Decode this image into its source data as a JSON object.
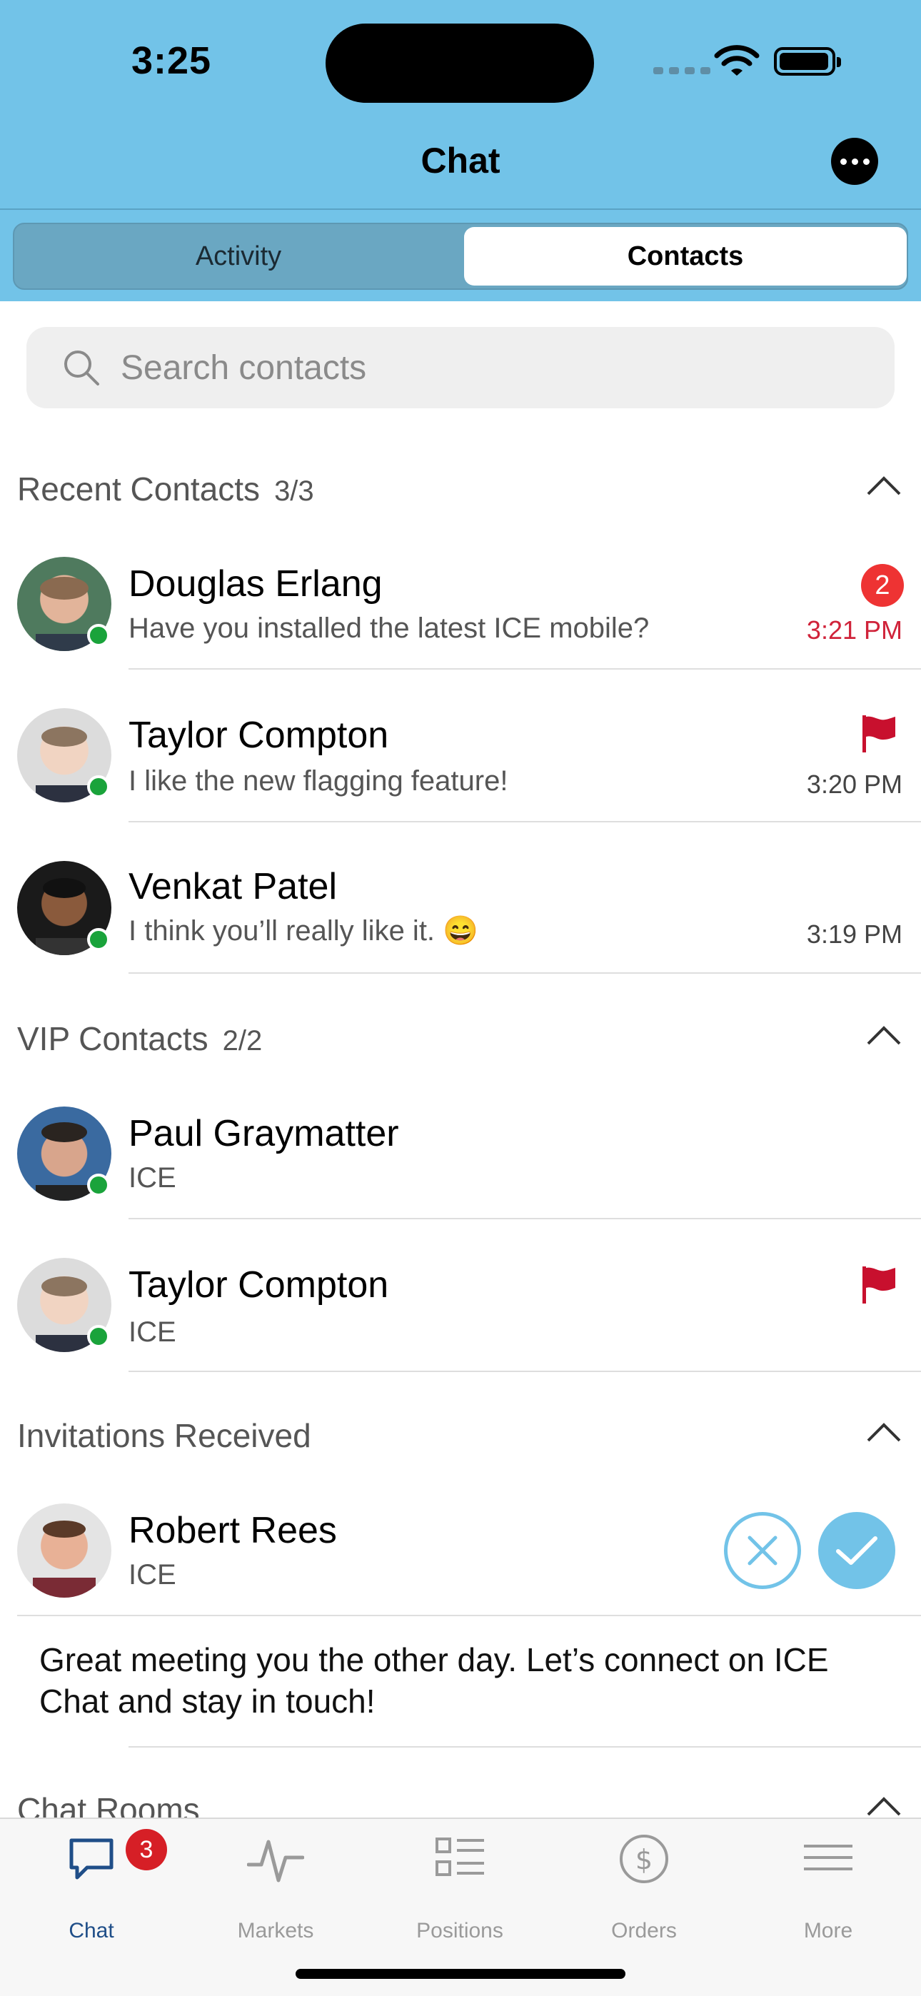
{
  "status_bar": {
    "time": "3:25"
  },
  "nav": {
    "title": "Chat"
  },
  "segments": {
    "activity": "Activity",
    "contacts": "Contacts"
  },
  "search": {
    "placeholder": "Search contacts"
  },
  "recent": {
    "title": "Recent Contacts",
    "count": "3/3",
    "items": [
      {
        "name": "Douglas Erlang",
        "message": "Have you installed the latest ICE mobile?",
        "time": "3:21 PM",
        "badge": "2"
      },
      {
        "name": "Taylor Compton",
        "message": "I like the new flagging feature!",
        "time": "3:20 PM"
      },
      {
        "name": "Venkat Patel",
        "message": "I think you’ll really like it. 😄",
        "time": "3:19 PM"
      }
    ]
  },
  "vip": {
    "title": "VIP Contacts",
    "count": "2/2",
    "items": [
      {
        "name": "Paul Graymatter",
        "company": "ICE"
      },
      {
        "name": "Taylor Compton",
        "company": "ICE"
      }
    ]
  },
  "invitations": {
    "title": "Invitations Received",
    "items": [
      {
        "name": "Robert Rees",
        "company": "ICE",
        "message": "Great meeting you the other day. Let’s connect on ICE Chat and stay in touch!"
      }
    ]
  },
  "chat_rooms": {
    "title": "Chat Rooms"
  },
  "tabbar": {
    "chat": "Chat",
    "chat_badge": "3",
    "markets": "Markets",
    "positions": "Positions",
    "orders": "Orders",
    "more": "More"
  },
  "colors": {
    "header_bg": "#72c3e8",
    "unread_time": "#d0233a",
    "presence_online": "#1aa33b",
    "flag": "#c8102e",
    "tab_active": "#1f4e88"
  }
}
